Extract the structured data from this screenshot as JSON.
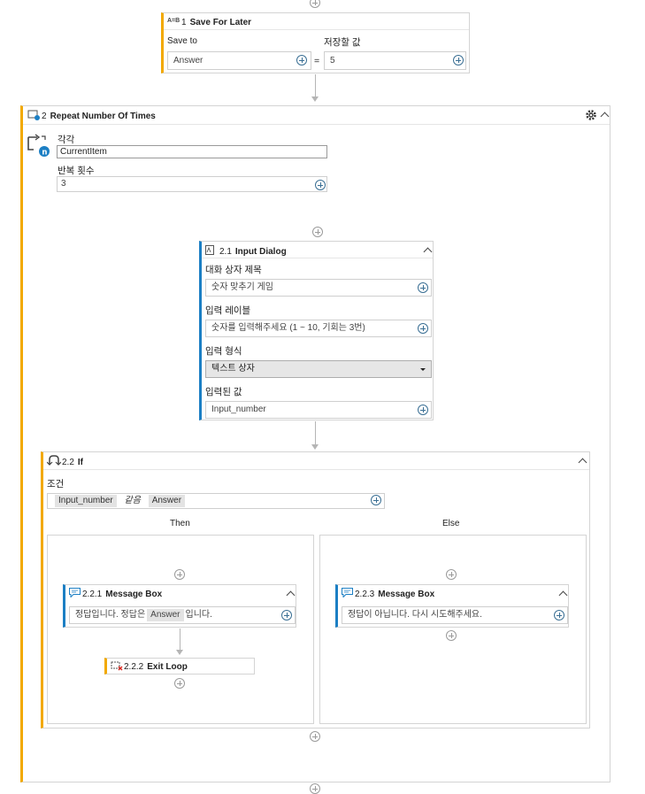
{
  "save": {
    "number": "1",
    "title": "Save For Later",
    "icon": "variable-icon",
    "save_to_label": "Save to",
    "value_label": "저장할 값",
    "variable": "Answer",
    "equals": "=",
    "value": "5"
  },
  "repeat": {
    "number": "2",
    "title": "Repeat Number Of Times",
    "icon": "loop-icon",
    "each_label": "각각",
    "each_value": "CurrentItem",
    "count_label": "반복 횟수",
    "count_value": "3"
  },
  "input_dialog": {
    "number": "2.1",
    "title": "Input Dialog",
    "icon": "dialog-icon",
    "title_label": "대화 상자 제목",
    "title_value": "숫자 맞추기 게임",
    "input_label_label": "입력 레이블",
    "input_label_value": "숫자를 입력해주세요 (1 ~ 10, 기회는 3번)",
    "input_type_label": "입력 형식",
    "input_type_value": "텍스트 상자",
    "entered_value_label": "입력된 값",
    "entered_value": "Input_number"
  },
  "if_block": {
    "number": "2.2",
    "title": "If",
    "icon": "if-icon",
    "condition_label": "조건",
    "cond_left": "Input_number",
    "cond_op": "같음",
    "cond_right": "Answer",
    "then_label": "Then",
    "else_label": "Else"
  },
  "msg_then": {
    "number": "2.2.1",
    "title": "Message Box",
    "text_before": "정답입니다. 정답은",
    "var": "Answer",
    "text_after": "입니다."
  },
  "exit_loop": {
    "number": "2.2.2",
    "title": "Exit Loop"
  },
  "msg_else": {
    "number": "2.2.3",
    "title": "Message Box",
    "text": "정답이 아닙니다. 다시 시도해주세요."
  },
  "colors": {
    "accent_orange": "#f2a900",
    "accent_blue": "#1c7fc4",
    "plus_blue": "#3a6f94"
  }
}
